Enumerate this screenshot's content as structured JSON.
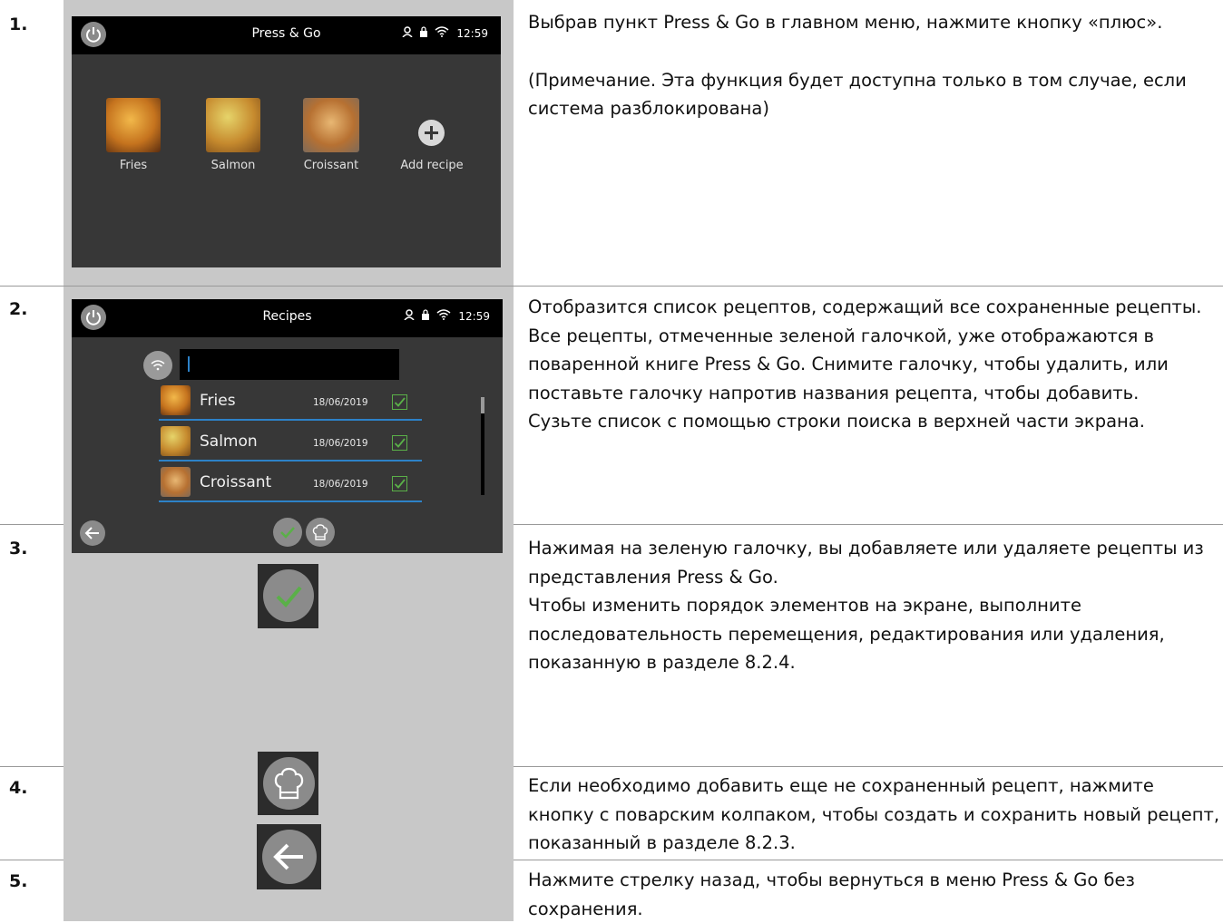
{
  "steps": [
    {
      "number": "1.",
      "text": [
        "Выбрав пункт Press & Go в главном меню, нажмите кнопку «плюс».",
        "(Примечание. Эта функция будет доступна только в том случае, если система разблокирована)"
      ]
    },
    {
      "number": "2.",
      "text": [
        "Отобразится список рецептов, содержащий все сохраненные рецепты.",
        "Все рецепты, отмеченные зеленой галочкой, уже отображаются в поваренной книге Press & Go. Снимите галочку, чтобы удалить, или поставьте галочку напротив названия рецепта, чтобы добавить.",
        "Сузьте список с помощью строки поиска в верхней части экрана."
      ]
    },
    {
      "number": "3.",
      "text": [
        "Нажимая на зеленую галочку, вы добавляете или удаляете рецепты из представления Press & Go.",
        "Чтобы изменить порядок элементов на экране, выполните последовательность перемещения, редактирования или удаления, показанную в разделе 8.2.4."
      ]
    },
    {
      "number": "4.",
      "text": [
        "Если необходимо добавить еще не сохраненный рецепт, нажмите кнопку с поварским колпаком, чтобы создать и сохранить новый рецепт, показанный в разделе 8.2.3."
      ]
    },
    {
      "number": "5.",
      "text": [
        "Нажмите стрелку назад, чтобы вернуться в меню Press & Go без сохранения."
      ]
    }
  ],
  "screen1": {
    "title": "Press & Go",
    "time": "12:59",
    "tiles": [
      "Fries",
      "Salmon",
      "Croissant",
      "Add recipe"
    ]
  },
  "screen2": {
    "title": "Recipes",
    "time": "12:59",
    "search_value": "",
    "recipes": [
      {
        "name": "Fries",
        "date": "18/06/2019",
        "checked": true
      },
      {
        "name": "Salmon",
        "date": "18/06/2019",
        "checked": true
      },
      {
        "name": "Croissant",
        "date": "18/06/2019",
        "checked": true
      }
    ]
  },
  "colors": {
    "accent_green": "#5ab048",
    "accent_blue": "#2d82c8",
    "screen_bg": "#373737"
  },
  "icons": [
    "power-icon",
    "user-icon",
    "lock-icon",
    "wifi-icon",
    "plus-icon",
    "check-icon",
    "chef-hat-icon",
    "back-arrow-icon"
  ]
}
